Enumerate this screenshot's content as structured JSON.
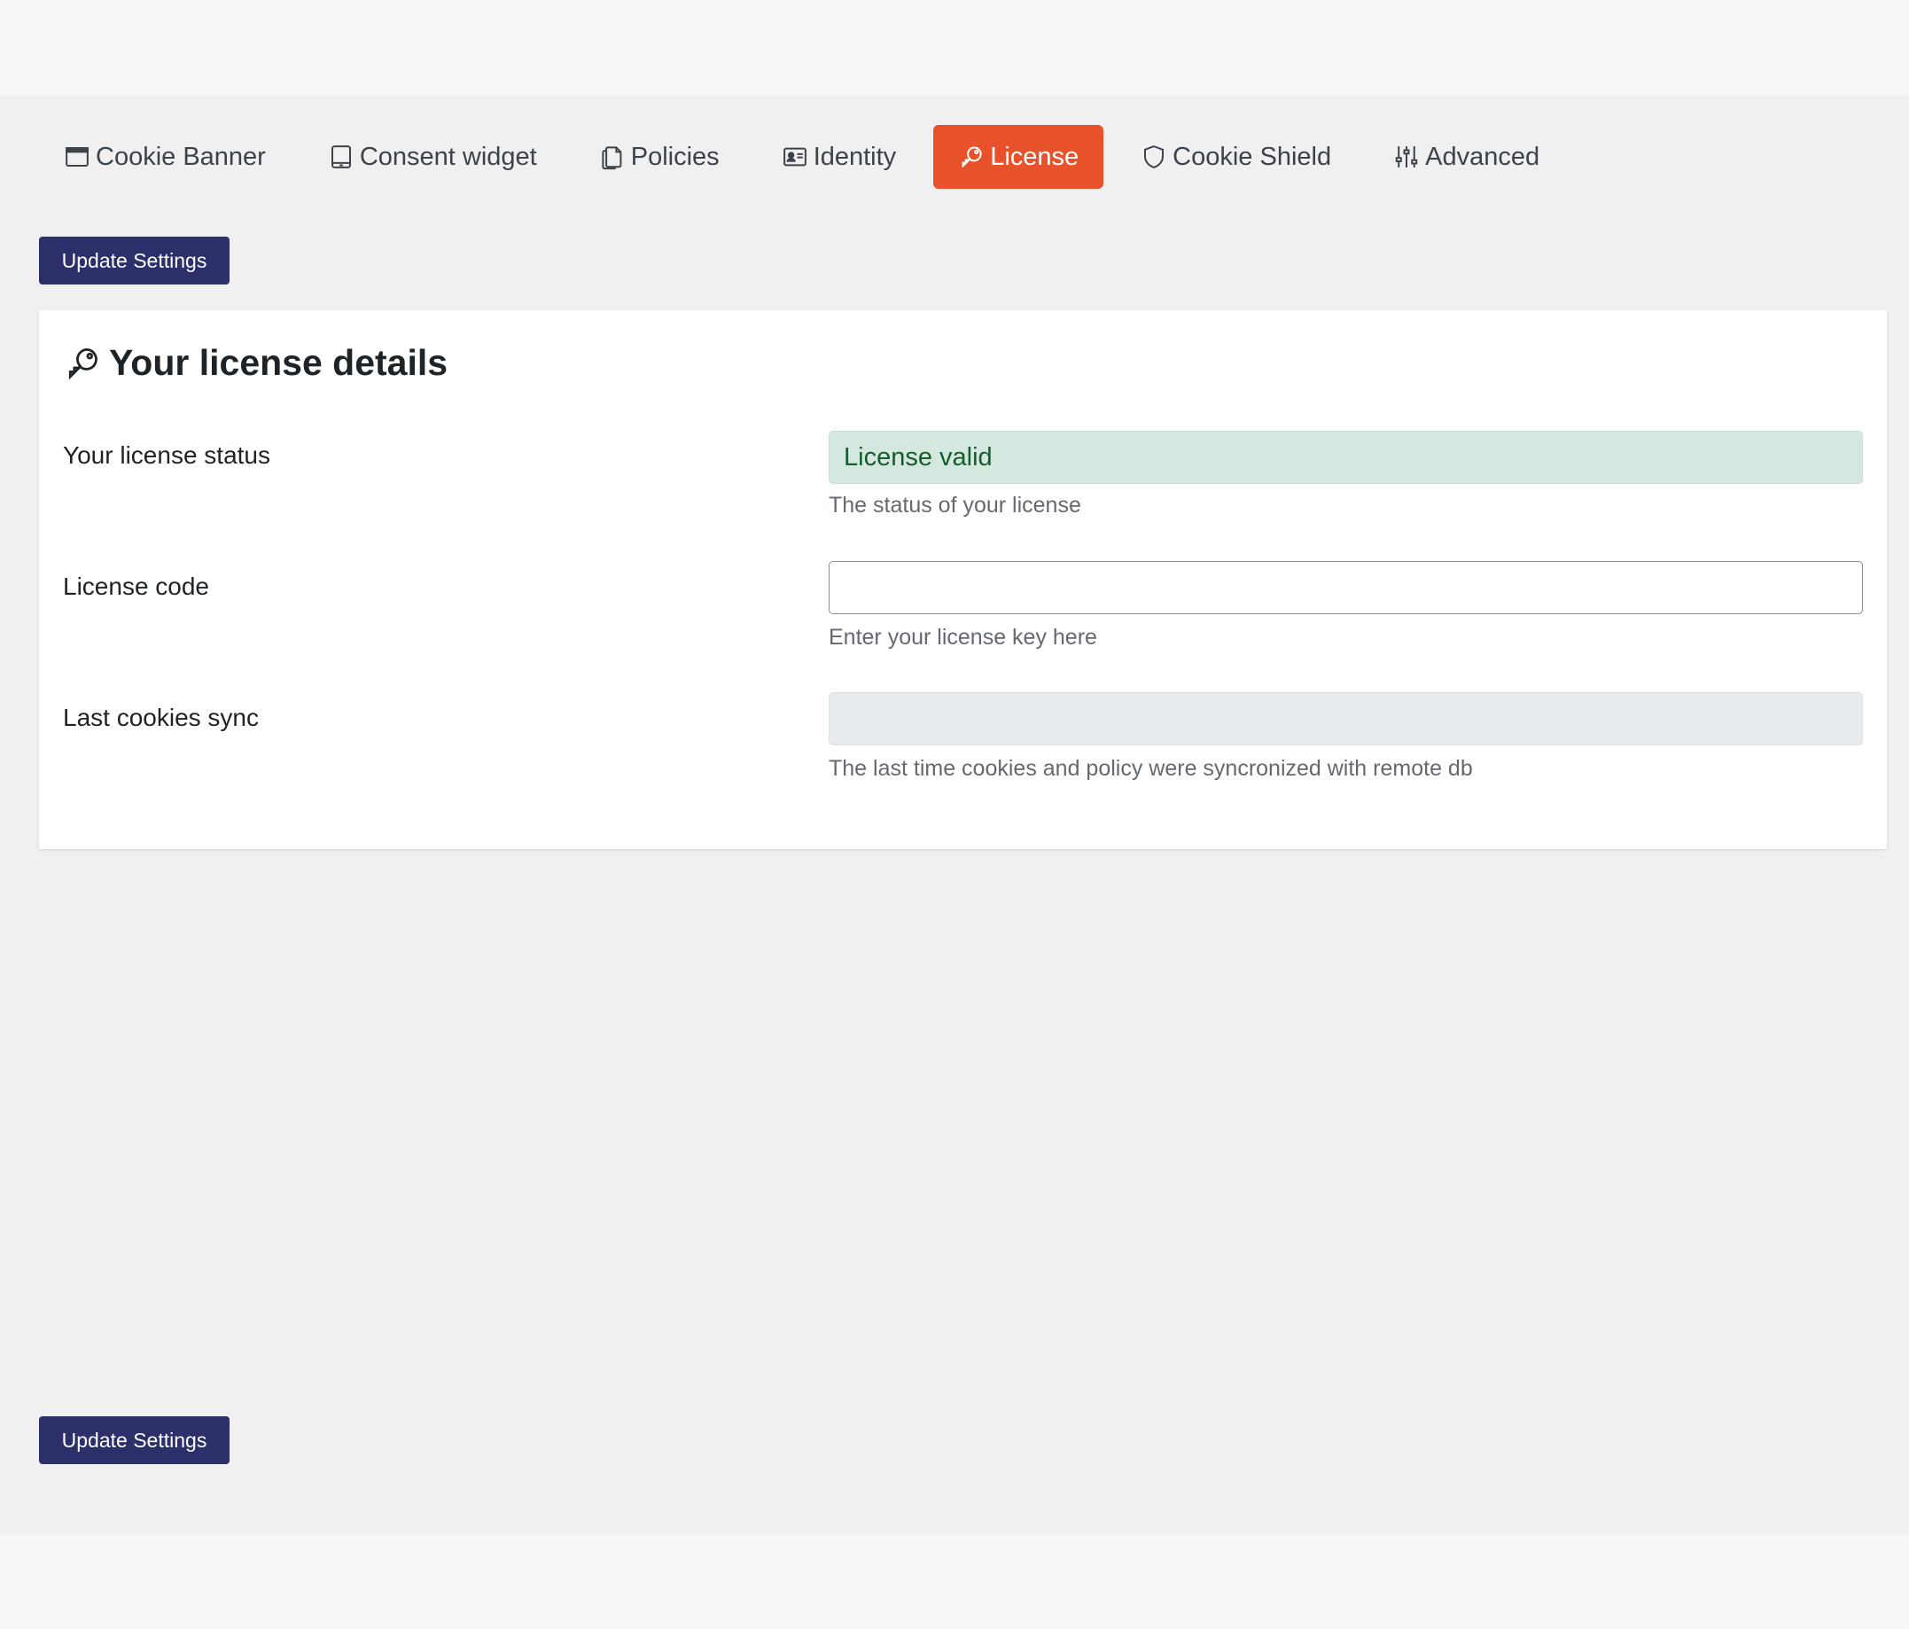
{
  "tabs": [
    {
      "label": "Cookie Banner",
      "icon": "browser-window-icon",
      "active": false
    },
    {
      "label": "Consent widget",
      "icon": "tablet-icon",
      "active": false
    },
    {
      "label": "Policies",
      "icon": "documents-icon",
      "active": false
    },
    {
      "label": "Identity",
      "icon": "id-card-icon",
      "active": false
    },
    {
      "label": "License",
      "icon": "key-icon",
      "active": true
    },
    {
      "label": "Cookie Shield",
      "icon": "shield-icon",
      "active": false
    },
    {
      "label": "Advanced",
      "icon": "sliders-icon",
      "active": false
    }
  ],
  "actions": {
    "update_label_top": "Update Settings",
    "update_label_bottom": "Update Settings"
  },
  "license_card": {
    "title": "Your license details",
    "title_icon": "key-icon",
    "status": {
      "label": "Your license status",
      "value": "License valid",
      "help": "The status of your license"
    },
    "code": {
      "label": "License code",
      "value": "",
      "help": "Enter your license key here"
    },
    "sync": {
      "label": "Last cookies sync",
      "value": "",
      "help": "The last time cookies and policy were syncronized with remote db"
    }
  },
  "colors": {
    "accent": "#e8522b",
    "button": "#2c2f6a",
    "status_bg": "#d4e8df",
    "status_text": "#155d2c"
  }
}
